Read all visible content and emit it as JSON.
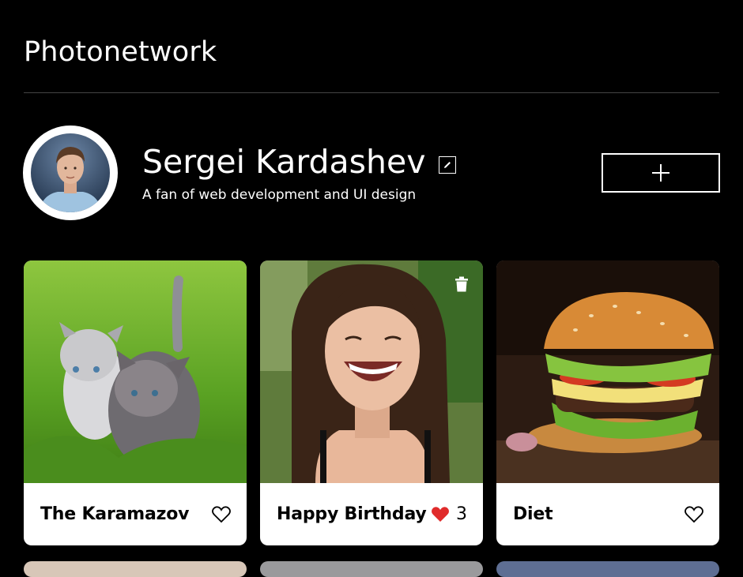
{
  "header": {
    "logo": "Photonetwork"
  },
  "profile": {
    "name": "Sergei Kardashev",
    "about": "A fan of web development and UI design",
    "add_button_icon": "plus-icon",
    "edit_button_icon": "pencil-icon"
  },
  "cards": [
    {
      "title": "The Karamazov",
      "liked": false,
      "likes": "",
      "deletable": false
    },
    {
      "title": "Happy Birthday",
      "liked": true,
      "likes": "3",
      "deletable": true
    },
    {
      "title": "Diet",
      "liked": false,
      "likes": "",
      "deletable": false
    }
  ],
  "colors": {
    "background": "#000000",
    "card": "#ffffff",
    "like_active": "#e02b2b"
  }
}
